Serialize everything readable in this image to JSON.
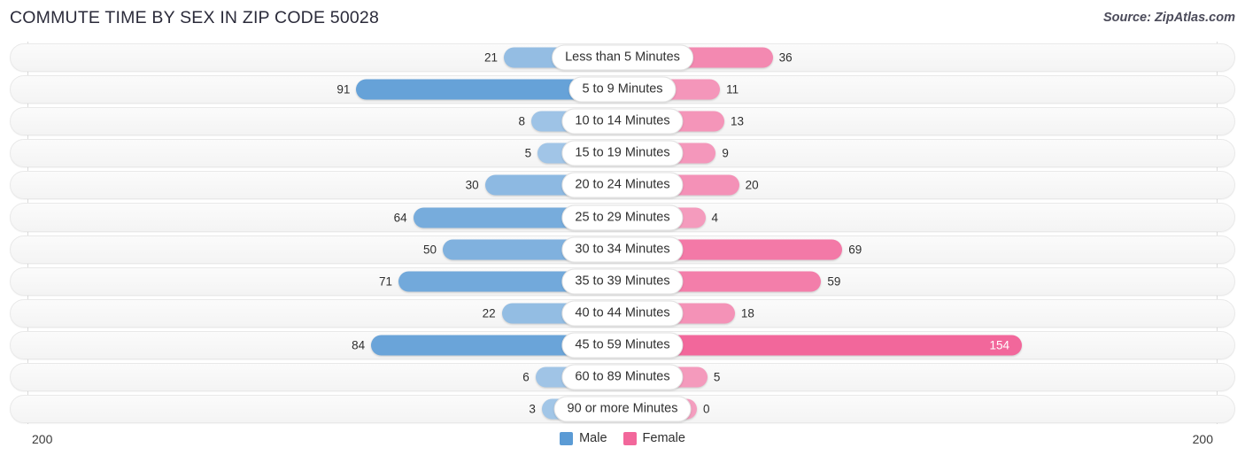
{
  "header": {
    "title": "COMMUTE TIME BY SEX IN ZIP CODE 50028",
    "source": "Source: ZipAtlas.com"
  },
  "axis": {
    "left_tick": "200",
    "right_tick": "200",
    "max": 200
  },
  "legend": {
    "items": [
      {
        "label": "Male",
        "color": "#5b9bd5"
      },
      {
        "label": "Female",
        "color": "#f2679b"
      }
    ]
  },
  "colors": {
    "male_dark": "#5b9bd5",
    "male_light": "#a6c8e8",
    "female_dark": "#f2679b",
    "female_light": "#f49ebf",
    "track_bg": "#f7f7f7",
    "axis": "#dcdcdc"
  },
  "chart_data": {
    "type": "bar",
    "orientation": "diverging-horizontal",
    "title": "COMMUTE TIME BY SEX IN ZIP CODE 50028",
    "xlabel": "",
    "ylabel": "",
    "xlim": [
      200,
      200
    ],
    "grid": false,
    "legend_position": "bottom-center",
    "categories": [
      "Less than 5 Minutes",
      "5 to 9 Minutes",
      "10 to 14 Minutes",
      "15 to 19 Minutes",
      "20 to 24 Minutes",
      "25 to 29 Minutes",
      "30 to 34 Minutes",
      "35 to 39 Minutes",
      "40 to 44 Minutes",
      "45 to 59 Minutes",
      "60 to 89 Minutes",
      "90 or more Minutes"
    ],
    "series": [
      {
        "name": "Male",
        "color": "#5b9bd5",
        "values": [
          21,
          91,
          8,
          5,
          30,
          64,
          50,
          71,
          22,
          84,
          6,
          3
        ]
      },
      {
        "name": "Female",
        "color": "#f2679b",
        "values": [
          36,
          11,
          13,
          9,
          20,
          4,
          69,
          59,
          18,
          154,
          5,
          0
        ]
      }
    ]
  },
  "rows": [
    {
      "category": "Less than 5 Minutes",
      "male": "21",
      "female": "36"
    },
    {
      "category": "5 to 9 Minutes",
      "male": "91",
      "female": "11"
    },
    {
      "category": "10 to 14 Minutes",
      "male": "8",
      "female": "13"
    },
    {
      "category": "15 to 19 Minutes",
      "male": "5",
      "female": "9"
    },
    {
      "category": "20 to 24 Minutes",
      "male": "30",
      "female": "20"
    },
    {
      "category": "25 to 29 Minutes",
      "male": "64",
      "female": "4"
    },
    {
      "category": "30 to 34 Minutes",
      "male": "50",
      "female": "69"
    },
    {
      "category": "35 to 39 Minutes",
      "male": "71",
      "female": "59"
    },
    {
      "category": "40 to 44 Minutes",
      "male": "22",
      "female": "18"
    },
    {
      "category": "45 to 59 Minutes",
      "male": "84",
      "female": "154"
    },
    {
      "category": "60 to 89 Minutes",
      "male": "6",
      "female": "5"
    },
    {
      "category": "90 or more Minutes",
      "male": "3",
      "female": "0"
    }
  ]
}
